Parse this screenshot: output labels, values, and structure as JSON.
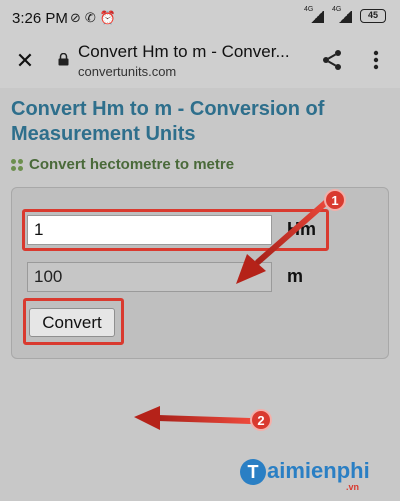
{
  "status_bar": {
    "time": "3:26 PM",
    "icons_left": [
      "no-sim-icon",
      "call-icon",
      "alarm-icon"
    ],
    "network_1": "4G",
    "network_2": "4G",
    "battery": "45"
  },
  "browser": {
    "title": "Convert Hm to m - Conver...",
    "url": "convertunits.com",
    "icons": [
      "close-icon",
      "lock-icon",
      "share-icon",
      "more-vert-icon"
    ]
  },
  "page": {
    "heading": "Convert Hm to m - Conversion of Measurement Units",
    "section_title": "Convert hectometre to metre",
    "converter": {
      "input_value": "1",
      "input_unit": "Hm",
      "output_value": "100",
      "output_unit": "m",
      "convert_label": "Convert"
    }
  },
  "annotations": {
    "badge_1": "1",
    "badge_2": "2",
    "highlight_color": "#d93a2f"
  },
  "watermark": {
    "logo_letter": "T",
    "text": "aimienphi",
    "sub": ".vn"
  }
}
